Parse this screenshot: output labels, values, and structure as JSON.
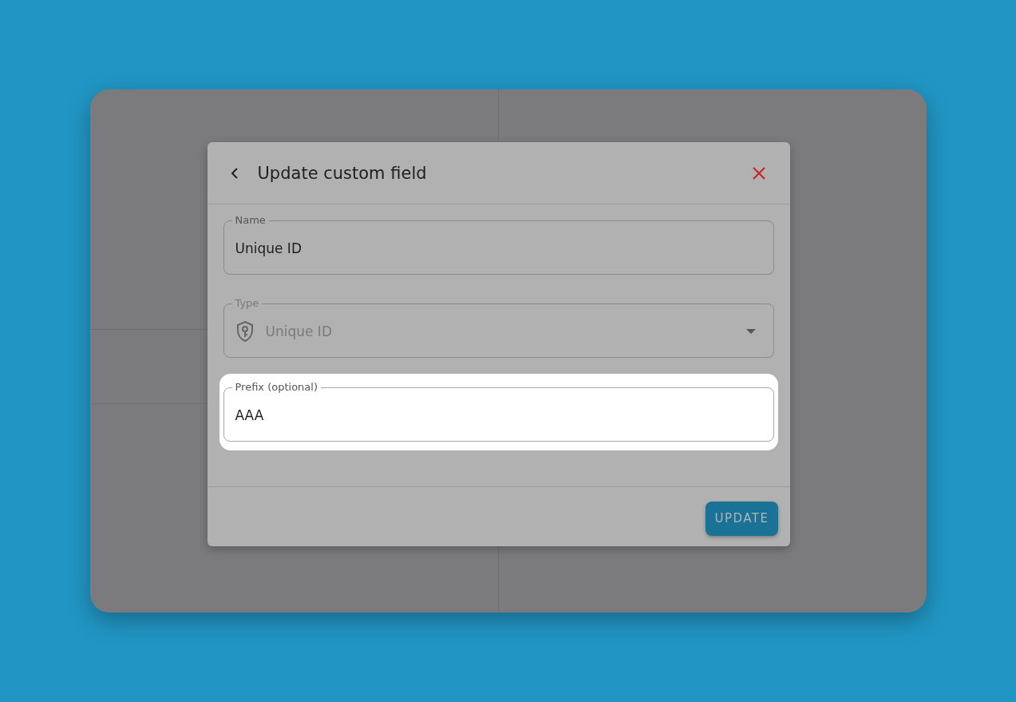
{
  "dialog": {
    "title": "Update custom field",
    "fields": [
      {
        "kind": "text",
        "label": "Name",
        "value": "Unique ID",
        "disabled": false,
        "highlighted": false
      },
      {
        "kind": "select",
        "label": "Type",
        "value": "Unique ID",
        "disabled": true,
        "highlighted": false
      },
      {
        "kind": "text",
        "label": "Prefix (optional)",
        "value": "AAA",
        "disabled": false,
        "highlighted": true
      }
    ],
    "buttons": [
      "UPDATE"
    ]
  }
}
